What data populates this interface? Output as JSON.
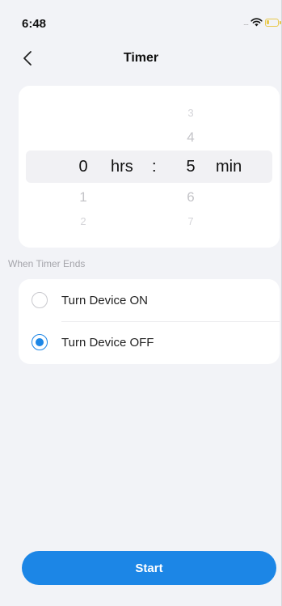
{
  "status_bar": {
    "time": "6:48",
    "signal_dots": "....",
    "icons": [
      "wifi-icon",
      "battery-icon"
    ]
  },
  "nav": {
    "back_icon": "chevron-left-icon",
    "title": "Timer"
  },
  "picker": {
    "hours": {
      "prev2": "",
      "prev1": "",
      "selected": "0",
      "next1": "1",
      "next2": "2"
    },
    "minutes": {
      "prev2": "3",
      "prev1": "4",
      "selected": "5",
      "next1": "6",
      "next2": "7"
    },
    "hours_unit": "hrs",
    "separator": ":",
    "minutes_unit": "min"
  },
  "section": {
    "label": "When Timer Ends"
  },
  "options": [
    {
      "label": "Turn Device ON",
      "selected": false
    },
    {
      "label": "Turn Device OFF",
      "selected": true
    }
  ],
  "start_button": {
    "label": "Start"
  },
  "colors": {
    "accent": "#1c86e6",
    "background": "#f2f3f7",
    "battery": "#e8c84a"
  }
}
